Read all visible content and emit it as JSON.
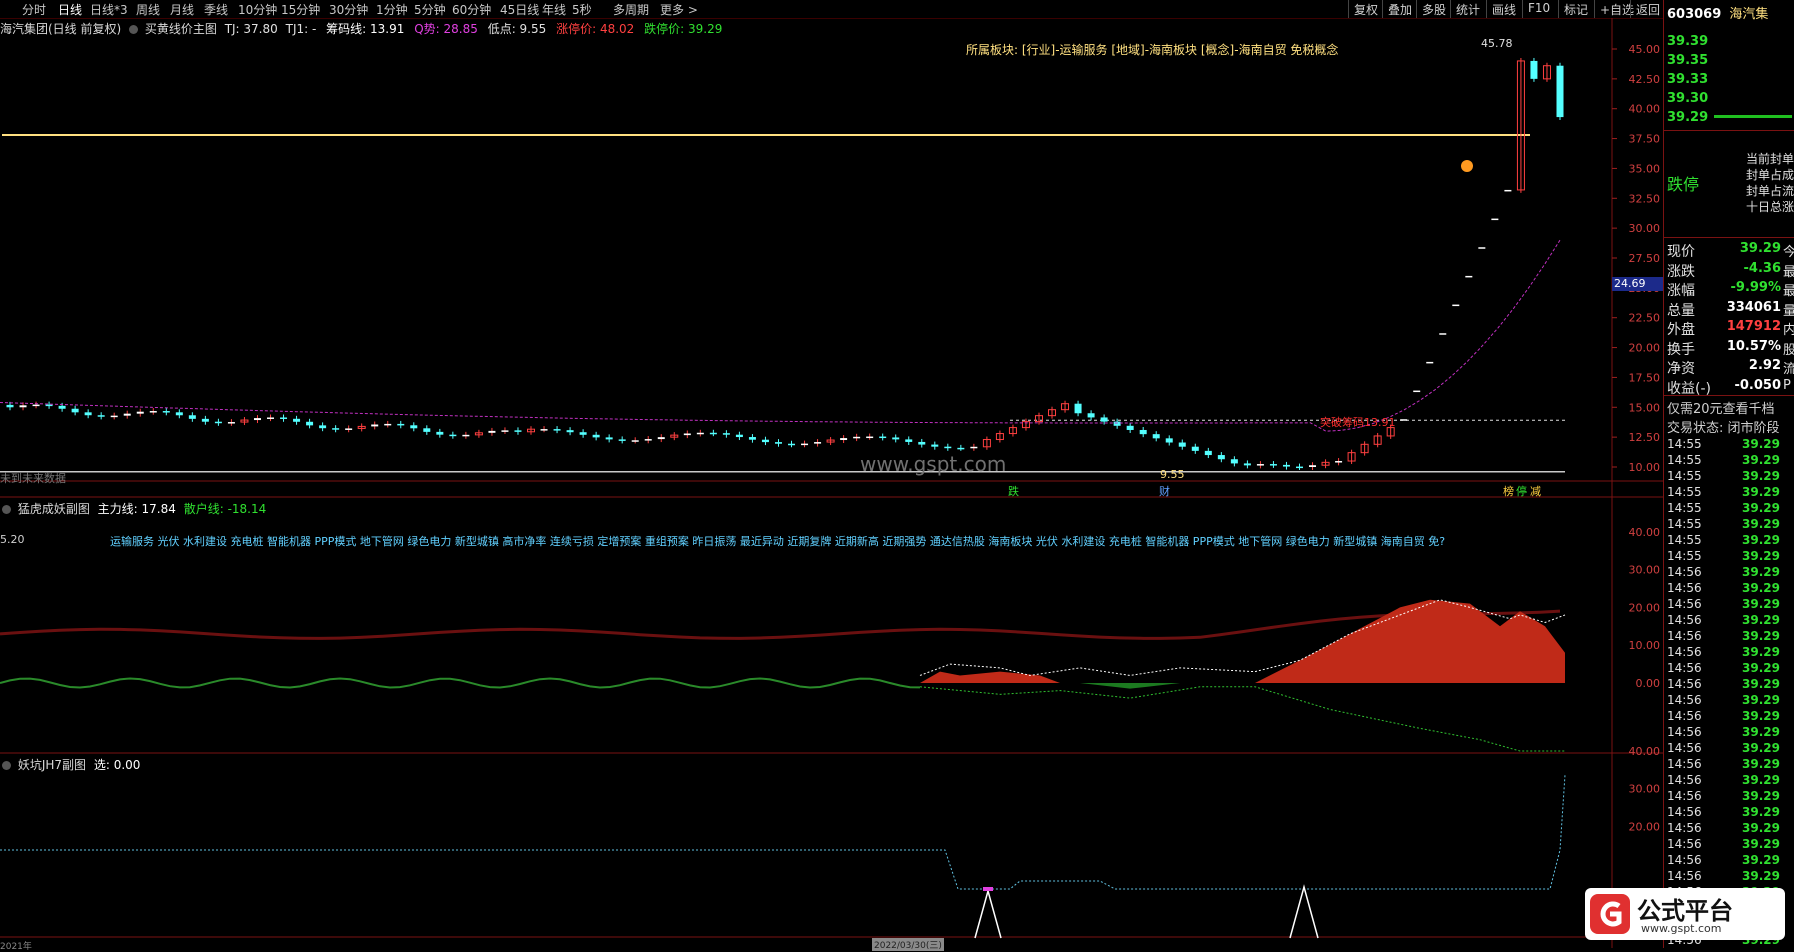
{
  "toolbar": {
    "periods": [
      "分时",
      "日线",
      "日线*3",
      "周线",
      "月线",
      "季线",
      "10分钟",
      "15分钟",
      "30分钟",
      "1分钟",
      "5分钟",
      "60分钟",
      "45日线",
      "年线",
      "5秒",
      "多周期",
      "更多 >"
    ],
    "active_period": "日线",
    "buttons": [
      "复权",
      "叠加",
      "多股",
      "统计",
      "画线",
      "F10",
      "标记",
      "+自选",
      "返回"
    ]
  },
  "main_chart": {
    "title": "海汽集团(日线 前复权)",
    "indicator": "买黄线价主图",
    "tj": "TJ: 37.80",
    "tj1": "TJ1: -",
    "chip_line": "筹码线: 13.91",
    "strength": "Q势: 28.85",
    "low_point": "低点: 9.55",
    "limit_up": "涨停价: 48.02",
    "limit_down": "跌停价: 39.29",
    "sector_text": "所属板块: [行业]-运输服务 [地域]-海南板块 [概念]-海南自贸 免税概念",
    "high_label": "45.78",
    "price_axis": [
      "45.00",
      "42.50",
      "40.00",
      "37.50",
      "35.00",
      "32.50",
      "30.00",
      "27.50",
      "25.00",
      "22.50",
      "20.00",
      "17.50",
      "15.00",
      "12.50",
      "10.00"
    ],
    "current_tag": "24.69",
    "breakout_label": "突破筹码13.91",
    "low_label": "9.55",
    "no_data": "未到未来数据",
    "watermark": "www.gspt.com",
    "event_marks": [
      "跌",
      "财",
      "榜",
      "停",
      "减"
    ],
    "gold_line_price": 37.8,
    "colors": {
      "up": "#ff4040",
      "down": "#54ffff",
      "ma": "#c030c0",
      "gold": "#ffe080"
    }
  },
  "sub_chart1": {
    "title": "猛虎成妖副图",
    "main_force": "主力线: 17.84",
    "retail": "散户线: -18.14",
    "left_value": "5.20",
    "concepts": "运输服务 光伏 水利建设 充电桩 智能机器 PPP模式 地下管网 绿色电力 新型城镇 高市净率 连续亏损 定增预案 重组预案 昨日振荡 最近异动 近期复牌 近期新高 近期强势 通达信热股 海南板块 光伏 水利建设 充电桩 智能机器 PPP模式 地下管网 绿色电力 新型城镇 海南自贸 免?",
    "axis": [
      "40.00",
      "30.00",
      "20.00",
      "10.00",
      "0.00"
    ]
  },
  "sub_chart2": {
    "title": "妖坑JH7副图",
    "select": "选: 0.00",
    "axis": [
      "40.00",
      "30.00",
      "20.00"
    ]
  },
  "bottom_labels": [
    "2021年",
    "2022/03/30(三)"
  ],
  "right_panel": {
    "code": "603069",
    "name": "海汽集",
    "order_book": [
      {
        "price": "39.39"
      },
      {
        "price": "39.35"
      },
      {
        "price": "39.33"
      },
      {
        "price": "39.30"
      },
      {
        "price": "39.29"
      }
    ],
    "status": "跌停",
    "seal_lines": [
      "当前封单",
      "封单占成",
      "封单占流",
      "十日总涨"
    ],
    "quote": [
      {
        "label": "现价",
        "value": "39.29",
        "extra": "今"
      },
      {
        "label": "涨跌",
        "value": "-4.36",
        "extra": "最"
      },
      {
        "label": "涨幅",
        "value": "-9.99%",
        "extra": "最"
      },
      {
        "label": "总量",
        "value": "334061",
        "extra": "量"
      },
      {
        "label": "外盘",
        "value": "147912",
        "extra": "内"
      },
      {
        "label": "换手",
        "value": "10.57%",
        "extra": "股"
      },
      {
        "label": "净资",
        "value": "2.92",
        "extra": "流"
      },
      {
        "label": "收益(-)",
        "value": "-0.050",
        "extra": "P"
      }
    ],
    "promo": "仅需20元查看千档",
    "trade_state": "交易状态: 闭市阶段",
    "ticks": [
      {
        "t": "14:55",
        "p": "39.29"
      },
      {
        "t": "14:55",
        "p": "39.29"
      },
      {
        "t": "14:55",
        "p": "39.29"
      },
      {
        "t": "14:55",
        "p": "39.29"
      },
      {
        "t": "14:55",
        "p": "39.29"
      },
      {
        "t": "14:55",
        "p": "39.29"
      },
      {
        "t": "14:55",
        "p": "39.29"
      },
      {
        "t": "14:55",
        "p": "39.29"
      },
      {
        "t": "14:56",
        "p": "39.29"
      },
      {
        "t": "14:56",
        "p": "39.29"
      },
      {
        "t": "14:56",
        "p": "39.29"
      },
      {
        "t": "14:56",
        "p": "39.29"
      },
      {
        "t": "14:56",
        "p": "39.29"
      },
      {
        "t": "14:56",
        "p": "39.29"
      },
      {
        "t": "14:56",
        "p": "39.29"
      },
      {
        "t": "14:56",
        "p": "39.29"
      },
      {
        "t": "14:56",
        "p": "39.29"
      },
      {
        "t": "14:56",
        "p": "39.29"
      },
      {
        "t": "14:56",
        "p": "39.29"
      },
      {
        "t": "14:56",
        "p": "39.29"
      },
      {
        "t": "14:56",
        "p": "39.29"
      },
      {
        "t": "14:56",
        "p": "39.29"
      },
      {
        "t": "14:56",
        "p": "39.29"
      },
      {
        "t": "14:56",
        "p": "39.29"
      },
      {
        "t": "14:56",
        "p": "39.29"
      },
      {
        "t": "14:56",
        "p": "39.29"
      },
      {
        "t": "14:56",
        "p": "39.29"
      },
      {
        "t": "14:56",
        "p": "39.29"
      },
      {
        "t": "14:56",
        "p": "39.29"
      },
      {
        "t": "14:56",
        "p": "39.29"
      },
      {
        "t": "14:56",
        "p": "39.29"
      },
      {
        "t": "14:56",
        "p": "39.29"
      }
    ]
  },
  "logo": {
    "text": "公式平台",
    "url": "www.gspt.com"
  }
}
